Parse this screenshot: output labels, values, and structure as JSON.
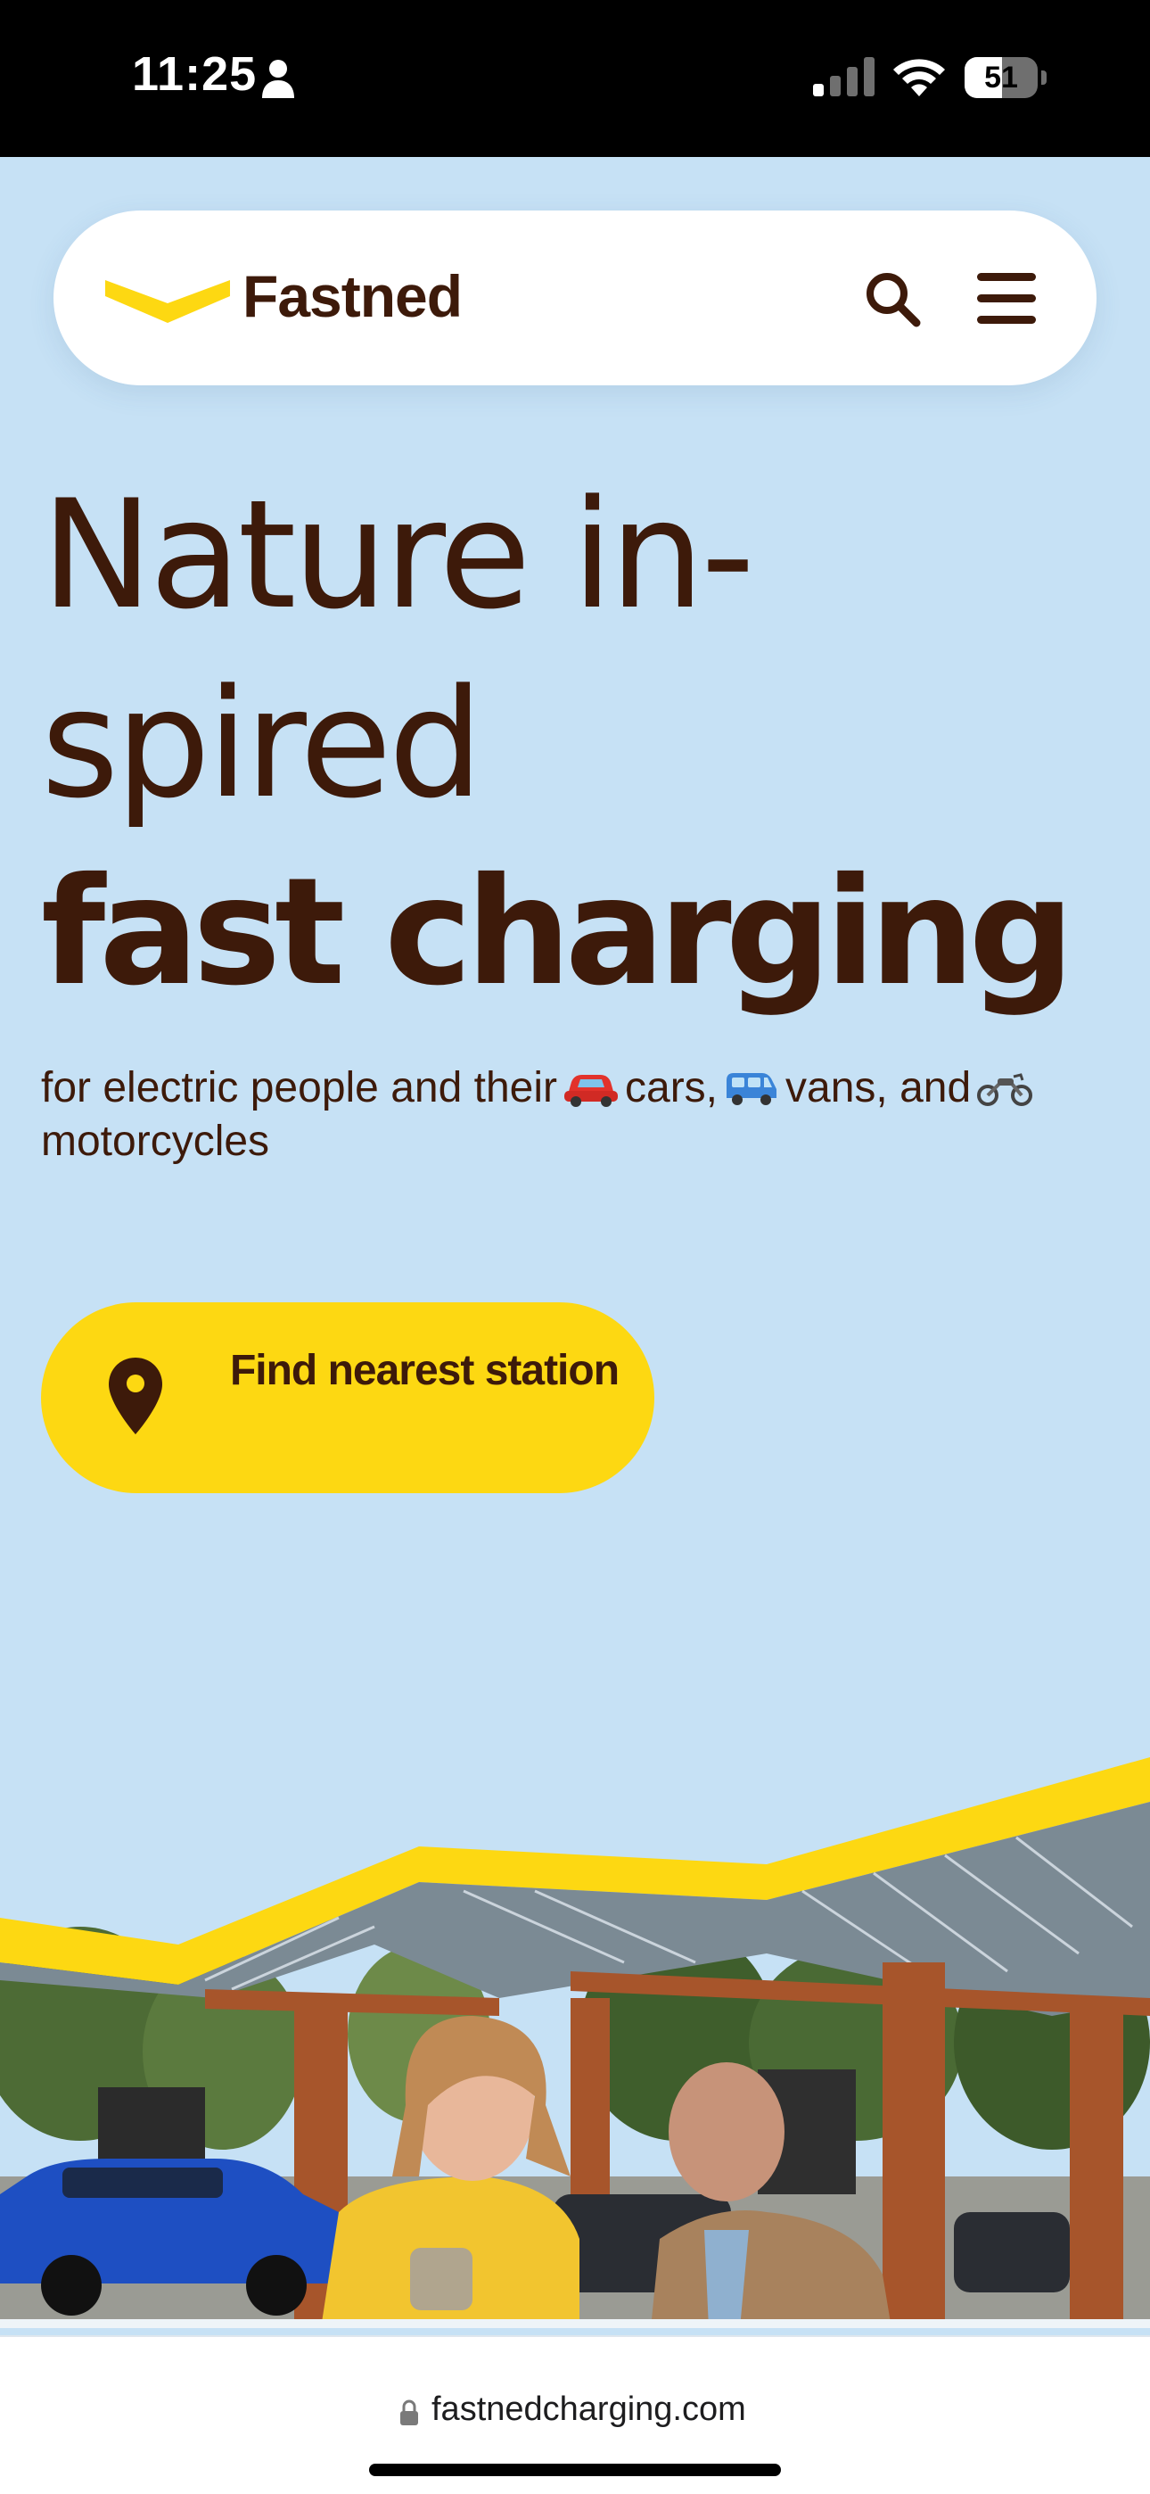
{
  "status_bar": {
    "time": "11:25",
    "battery_percent": 51,
    "battery_label": "51",
    "icons": [
      "person-icon",
      "cellular-signal-icon",
      "wifi-icon",
      "battery-icon"
    ]
  },
  "header": {
    "brand": "Fastned",
    "brand_color": "#fdd812",
    "text_color": "#3d1a0a",
    "icons": [
      "search-icon",
      "hamburger-menu-icon"
    ]
  },
  "hero": {
    "title_line_1": "Nature in-",
    "title_line_2": "spired",
    "title_line_3": "fast charging",
    "subtitle_part_1": "for electric people and their",
    "subtitle_cars": "cars,",
    "subtitle_vans": "vans, and",
    "subtitle_motorcycles": "motorcycles",
    "emoji_icons": [
      "red-car-emoji",
      "blue-van-emoji",
      "motorcycle-emoji"
    ],
    "background_color": "#c6e1f5"
  },
  "cta": {
    "label": "Find nearest station",
    "icon": "location-pin-icon",
    "color": "#fdd812"
  },
  "browser": {
    "url": "fastnedcharging.com",
    "icon": "lock-icon"
  }
}
